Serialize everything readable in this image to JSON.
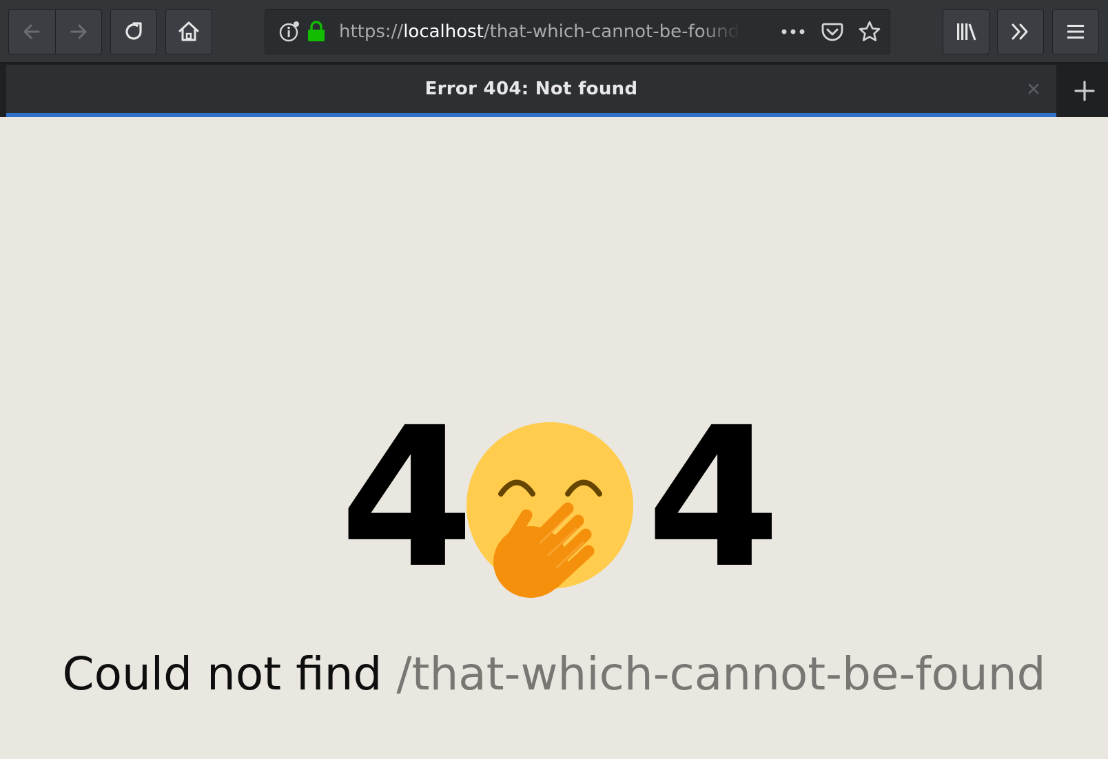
{
  "browser": {
    "url_scheme": "https://",
    "url_host": "localhost",
    "url_path": "/that-which-cannot-be-found",
    "tab_title": "Error 404: Not found",
    "colors": {
      "toolbar": "#323639",
      "tab_accent": "#2f71c7",
      "secure_lock": "#12bc00"
    }
  },
  "icons": {
    "back": "arrow-left-icon",
    "forward": "arrow-right-icon",
    "reload": "reload-icon",
    "home": "home-icon",
    "site_info": "info-icon",
    "secure": "lock-icon",
    "page_actions": "more-dots-icon",
    "pocket": "pocket-icon",
    "bookmark": "star-icon",
    "library": "library-icon",
    "overflow": "chevron-double-right-icon",
    "menu": "hamburger-menu-icon",
    "tab_close": "close-icon",
    "new_tab": "plus-icon",
    "face": "face-with-hand-over-mouth-emoji"
  },
  "page": {
    "code_left": "4",
    "code_right": "4",
    "message_prefix": "Could not find",
    "message_path": "/that-which-cannot-be-found",
    "colors": {
      "background": "#eae7e0",
      "path_text": "#7a7673"
    }
  }
}
